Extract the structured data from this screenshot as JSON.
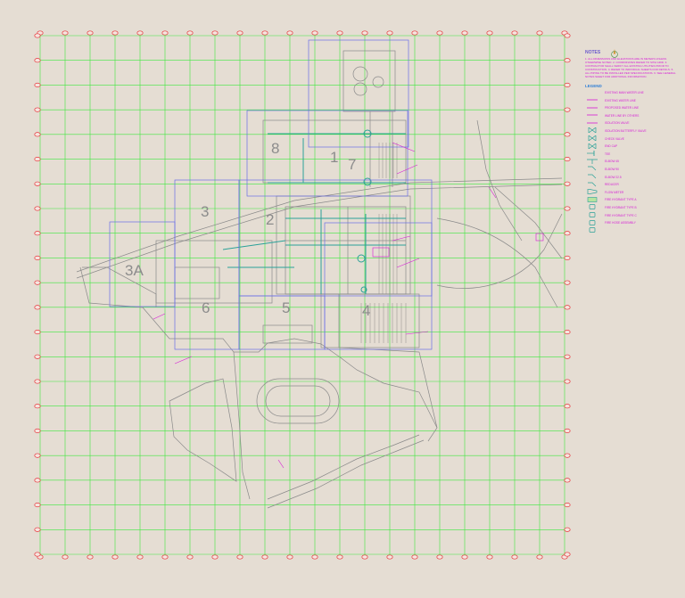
{
  "map": {
    "grid_columns": 22,
    "grid_rows": 22,
    "colors": {
      "background": "#e5ddd3",
      "grid": "#3ee83e",
      "grid_bubble": "#e8383e",
      "sheet_box": "#6a6ee6",
      "linework": "#8a8a8a",
      "piping": "#2aa198",
      "annotation": "#d61ad6"
    },
    "zones": [
      {
        "label": "1",
        "name": "zone-1"
      },
      {
        "label": "2",
        "name": "zone-2"
      },
      {
        "label": "3",
        "name": "zone-3"
      },
      {
        "label": "3A",
        "name": "zone-3a"
      },
      {
        "label": "4",
        "name": "zone-4"
      },
      {
        "label": "5",
        "name": "zone-5"
      },
      {
        "label": "6",
        "name": "zone-6"
      },
      {
        "label": "7",
        "name": "zone-7"
      },
      {
        "label": "8",
        "name": "zone-8"
      }
    ]
  },
  "legend": {
    "notes_title": "NOTES",
    "notes_text": "1. ALL DIMENSIONS AND ELEVATIONS ARE IN METERS UNLESS OTHERWISE NOTED. 2. COORDINATES REFER TO SITE GRID. 3. CONTRACTOR SHALL VERIFY ALL EXISTING UTILITIES PRIOR TO CONSTRUCTION. 4. REFER TO INDIVIDUAL SHEETS FOR DETAILS. 5. ALL PIPING TO BE INSTALLED PER SPECIFICATIONS. 6. SEE GENERAL NOTES SHEET FOR ADDITIONAL INFORMATION.",
    "symbols_title": "LEGEND",
    "items": [
      {
        "icon": "line-icon",
        "label": "EXISTING MAIN WATER LINE"
      },
      {
        "icon": "line-icon",
        "label": "EXISTING WATER LINE"
      },
      {
        "icon": "line-icon",
        "label": "PROPOSED WATER LINE"
      },
      {
        "icon": "line-icon",
        "label": "WATER LINE BY OTHERS"
      },
      {
        "icon": "valve-icon",
        "label": "ISOLATION VALVE"
      },
      {
        "icon": "valve-icon",
        "label": "ISOLATION BUTTERFLY VALVE"
      },
      {
        "icon": "valve-icon",
        "label": "CHECK VALVE"
      },
      {
        "icon": "cap-icon",
        "label": "END CAP"
      },
      {
        "icon": "tee-icon",
        "label": "TEE"
      },
      {
        "icon": "elbow-icon",
        "label": "ELBOW 45"
      },
      {
        "icon": "elbow-icon",
        "label": "ELBOW 90"
      },
      {
        "icon": "elbow-icon",
        "label": "ELBOW 22.5"
      },
      {
        "icon": "reducer-icon",
        "label": "REDUCER"
      },
      {
        "icon": "meter-icon",
        "label": "FLOW METER"
      },
      {
        "icon": "hydrant-icon",
        "label": "FIRE HYDRANT TYPE A"
      },
      {
        "icon": "hydrant-icon",
        "label": "FIRE HYDRANT TYPE B"
      },
      {
        "icon": "hydrant-icon",
        "label": "FIRE HYDRANT TYPE C"
      },
      {
        "icon": "hydrant-icon",
        "label": "FIRE HOSE ASSEMBLY"
      }
    ]
  }
}
